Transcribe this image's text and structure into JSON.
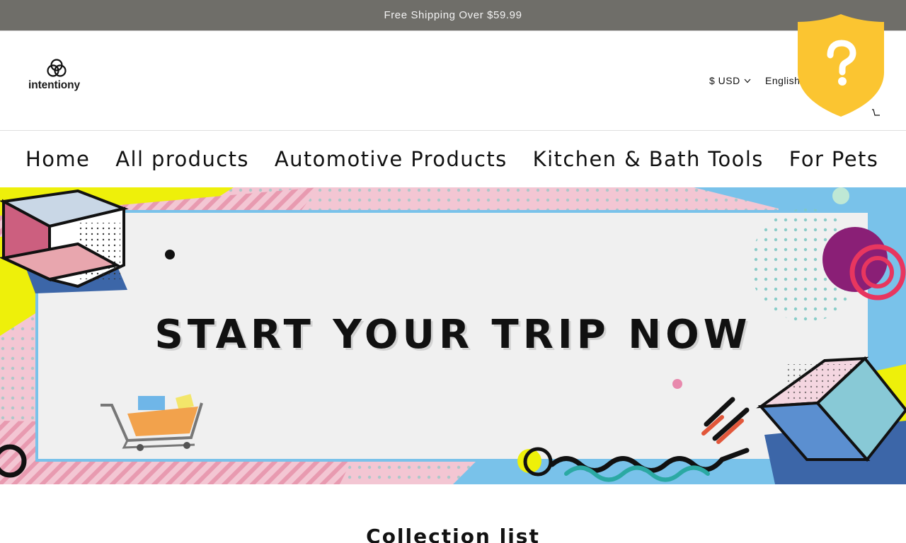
{
  "announcement": {
    "text": "Free Shipping Over $59.99"
  },
  "header": {
    "logo_text": "intentiony",
    "currency_label": "$ USD",
    "language_label": "English",
    "icons": [
      "chevron-down-icon",
      "shield-question-icon",
      "cart-icon"
    ]
  },
  "nav": {
    "items": [
      {
        "label": "Home"
      },
      {
        "label": "All products"
      },
      {
        "label": "Automotive Products"
      },
      {
        "label": "Kitchen & Bath Tools"
      },
      {
        "label": "For Pets"
      }
    ]
  },
  "hero": {
    "title": "START YOUR TRIP NOW",
    "colors": {
      "pink": "#f3c6d3",
      "blue": "#79c2ea",
      "yellow": "#eef00a",
      "panel": "#f0f0f0"
    }
  },
  "sections": {
    "collection_list_title": "Collection list"
  },
  "colors": {
    "announcement_bg": "#6f6e69",
    "shield": "#fbc531"
  }
}
